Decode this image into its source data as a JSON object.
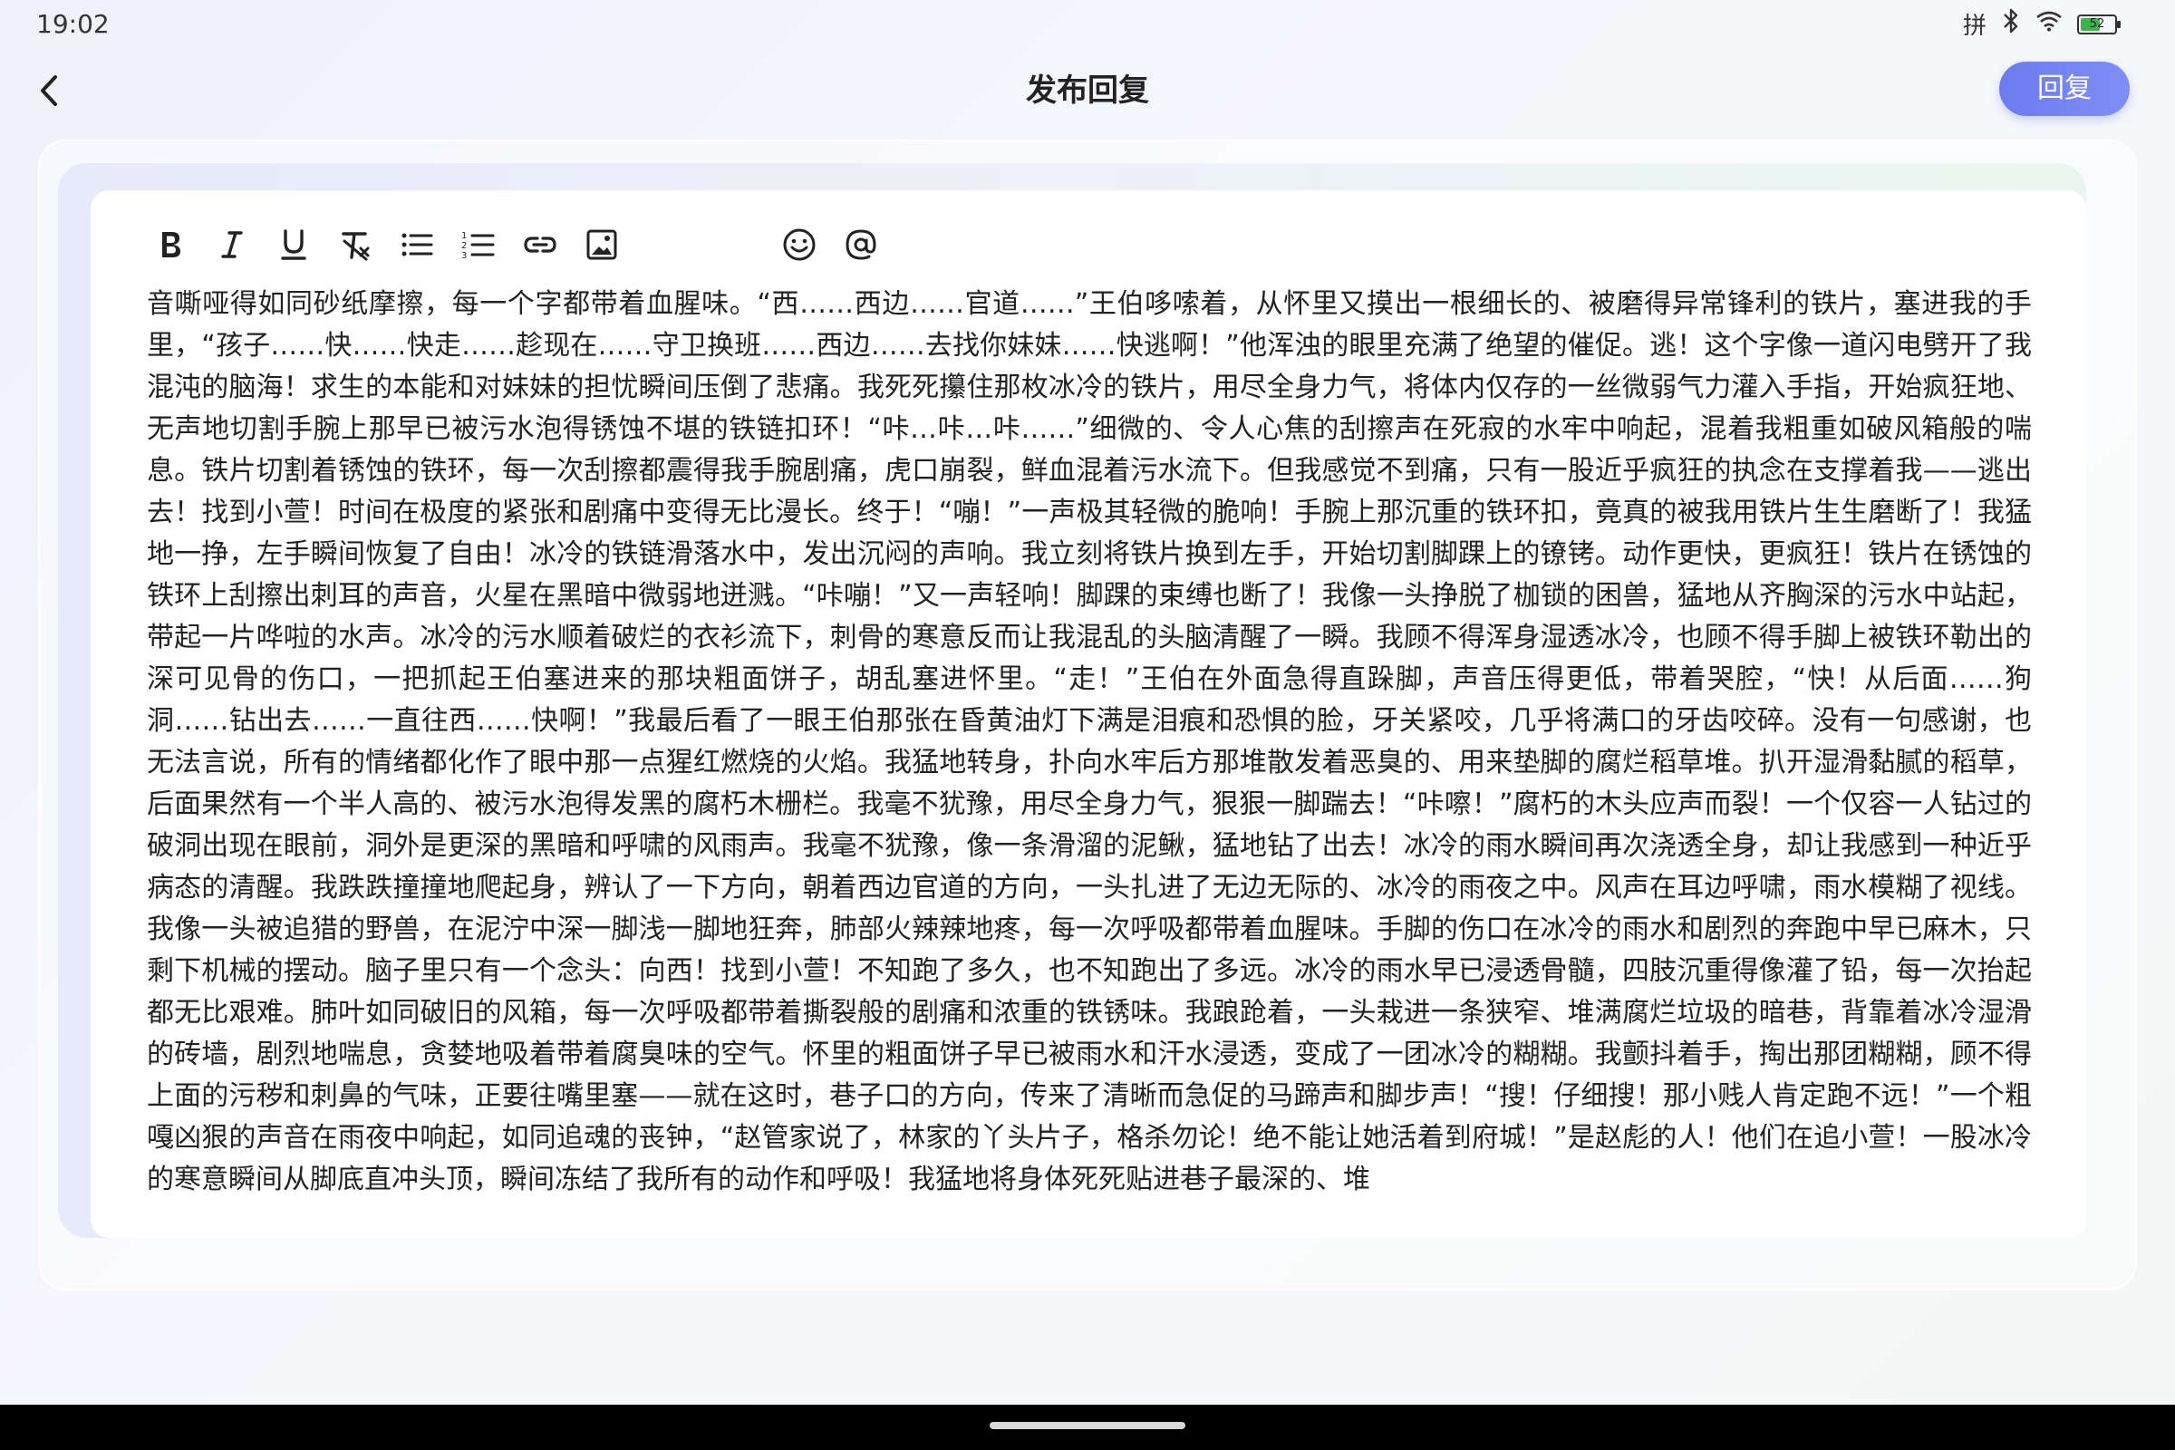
{
  "status": {
    "time": "19:02",
    "ime_label": "拼",
    "battery_level": "52"
  },
  "header": {
    "title": "发布回复",
    "reply_label": "回复"
  },
  "toolbar": {
    "tools": [
      "bold-icon",
      "italic-icon",
      "underline-icon",
      "clear-format-icon",
      "bullet-list-icon",
      "numbered-list-icon",
      "link-icon",
      "image-icon",
      "emoji-icon",
      "mention-icon"
    ]
  },
  "editor": {
    "content": "音嘶哑得如同砂纸摩擦，每一个字都带着血腥味。“西……西边……官道……”王伯哆嗦着，从怀里又摸出一根细长的、被磨得异常锋利的铁片，塞进我的手里，“孩子……快……快走……趁现在……守卫换班……西边……去找你妹妹……快逃啊！”他浑浊的眼里充满了绝望的催促。逃！这个字像一道闪电劈开了我混沌的脑海！求生的本能和对妹妹的担忧瞬间压倒了悲痛。我死死攥住那枚冰冷的铁片，用尽全身力气，将体内仅存的一丝微弱气力灌入手指，开始疯狂地、无声地切割手腕上那早已被污水泡得锈蚀不堪的铁链扣环！“咔…咔…咔……”细微的、令人心焦的刮擦声在死寂的水牢中响起，混着我粗重如破风箱般的喘息。铁片切割着锈蚀的铁环，每一次刮擦都震得我手腕剧痛，虎口崩裂，鲜血混着污水流下。但我感觉不到痛，只有一股近乎疯狂的执念在支撑着我——逃出去！找到小萱！时间在极度的紧张和剧痛中变得无比漫长。终于！“嘣！”一声极其轻微的脆响！手腕上那沉重的铁环扣，竟真的被我用铁片生生磨断了！我猛地一挣，左手瞬间恢复了自由！冰冷的铁链滑落水中，发出沉闷的声响。我立刻将铁片换到左手，开始切割脚踝上的镣铐。动作更快，更疯狂！铁片在锈蚀的铁环上刮擦出刺耳的声音，火星在黑暗中微弱地迸溅。“咔嘣！”又一声轻响！脚踝的束缚也断了！我像一头挣脱了枷锁的困兽，猛地从齐胸深的污水中站起，带起一片哗啦的水声。冰冷的污水顺着破烂的衣衫流下，刺骨的寒意反而让我混乱的头脑清醒了一瞬。我顾不得浑身湿透冰冷，也顾不得手脚上被铁环勒出的深可见骨的伤口，一把抓起王伯塞进来的那块粗面饼子，胡乱塞进怀里。“走！”王伯在外面急得直跺脚，声音压得更低，带着哭腔，“快！从后面……狗洞……钻出去……一直往西……快啊！”我最后看了一眼王伯那张在昏黄油灯下满是泪痕和恐惧的脸，牙关紧咬，几乎将满口的牙齿咬碎。没有一句感谢，也无法言说，所有的情绪都化作了眼中那一点猩红燃烧的火焰。我猛地转身，扑向水牢后方那堆散发着恶臭的、用来垫脚的腐烂稻草堆。扒开湿滑黏腻的稻草，后面果然有一个半人高的、被污水泡得发黑的腐朽木栅栏。我毫不犹豫，用尽全身力气，狠狠一脚踹去！“咔嚓！”腐朽的木头应声而裂！一个仅容一人钻过的破洞出现在眼前，洞外是更深的黑暗和呼啸的风雨声。我毫不犹豫，像一条滑溜的泥鳅，猛地钻了出去！冰冷的雨水瞬间再次浇透全身，却让我感到一种近乎病态的清醒。我跌跌撞撞地爬起身，辨认了一下方向，朝着西边官道的方向，一头扎进了无边无际的、冰冷的雨夜之中。风声在耳边呼啸，雨水模糊了视线。我像一头被追猎的野兽，在泥泞中深一脚浅一脚地狂奔，肺部火辣辣地疼，每一次呼吸都带着血腥味。手脚的伤口在冰冷的雨水和剧烈的奔跑中早已麻木，只剩下机械的摆动。脑子里只有一个念头：向西！找到小萱！不知跑了多久，也不知跑出了多远。冰冷的雨水早已浸透骨髓，四肢沉重得像灌了铅，每一次抬起都无比艰难。肺叶如同破旧的风箱，每一次呼吸都带着撕裂般的剧痛和浓重的铁锈味。我踉跄着，一头栽进一条狭窄、堆满腐烂垃圾的暗巷，背靠着冰冷湿滑的砖墙，剧烈地喘息，贪婪地吸着带着腐臭味的空气。怀里的粗面饼子早已被雨水和汗水浸透，变成了一团冰冷的糊糊。我颤抖着手，掏出那团糊糊，顾不得上面的污秽和刺鼻的气味，正要往嘴里塞——就在这时，巷子口的方向，传来了清晰而急促的马蹄声和脚步声！“搜！仔细搜！那小贱人肯定跑不远！”一个粗嘎凶狠的声音在雨夜中响起，如同追魂的丧钟，“赵管家说了，林家的丫头片子，格杀勿论！绝不能让她活着到府城！”是赵彪的人！他们在追小萱！一股冰冷的寒意瞬间从脚底直冲头顶，瞬间冻结了我所有的动作和呼吸！我猛地将身体死死贴进巷子最深的、堆"
  }
}
